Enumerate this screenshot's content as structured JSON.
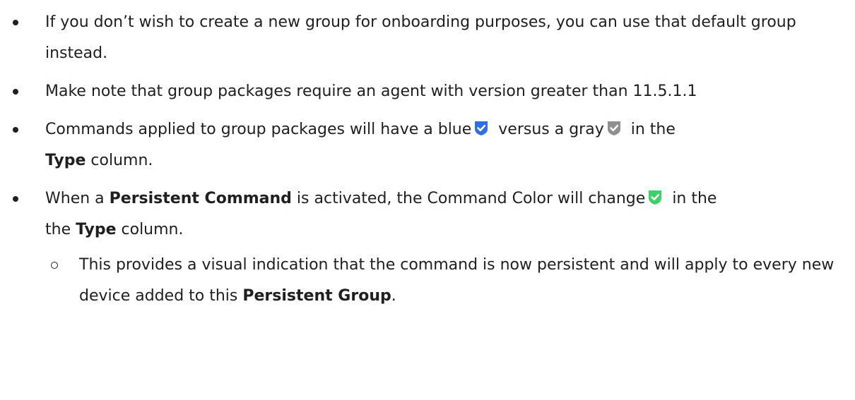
{
  "items": [
    {
      "text": "If you don’t wish to create a new group for onboarding purposes, you can use that default group instead."
    },
    {
      "text": "Make note that group packages require an agent with version greater than 11.5.1.1"
    },
    {
      "part1": "Commands applied to group packages will have a blue",
      "part2": "versus a gray",
      "part3": "in the",
      "bold1": "Type",
      "part4": "column.",
      "icons": [
        "blue-check-shield-icon",
        "gray-check-shield-icon"
      ]
    },
    {
      "part1": "When a",
      "bold1": "Persistent Command",
      "part2": "is activated, the Command Color will change",
      "part3": "in the",
      "bold2": "Type",
      "part4": "column.",
      "icons": [
        "green-check-shield-icon"
      ],
      "sub": {
        "text": "This provides a visual indication that the command is now persistent and will apply to every new device added to this",
        "bold": "Persistent Group",
        "end": "."
      }
    }
  ],
  "colors": {
    "blue": "#2f6fe0",
    "gray": "#8f8f8f",
    "green": "#3ccf6a",
    "text": "#1f1f1f"
  }
}
